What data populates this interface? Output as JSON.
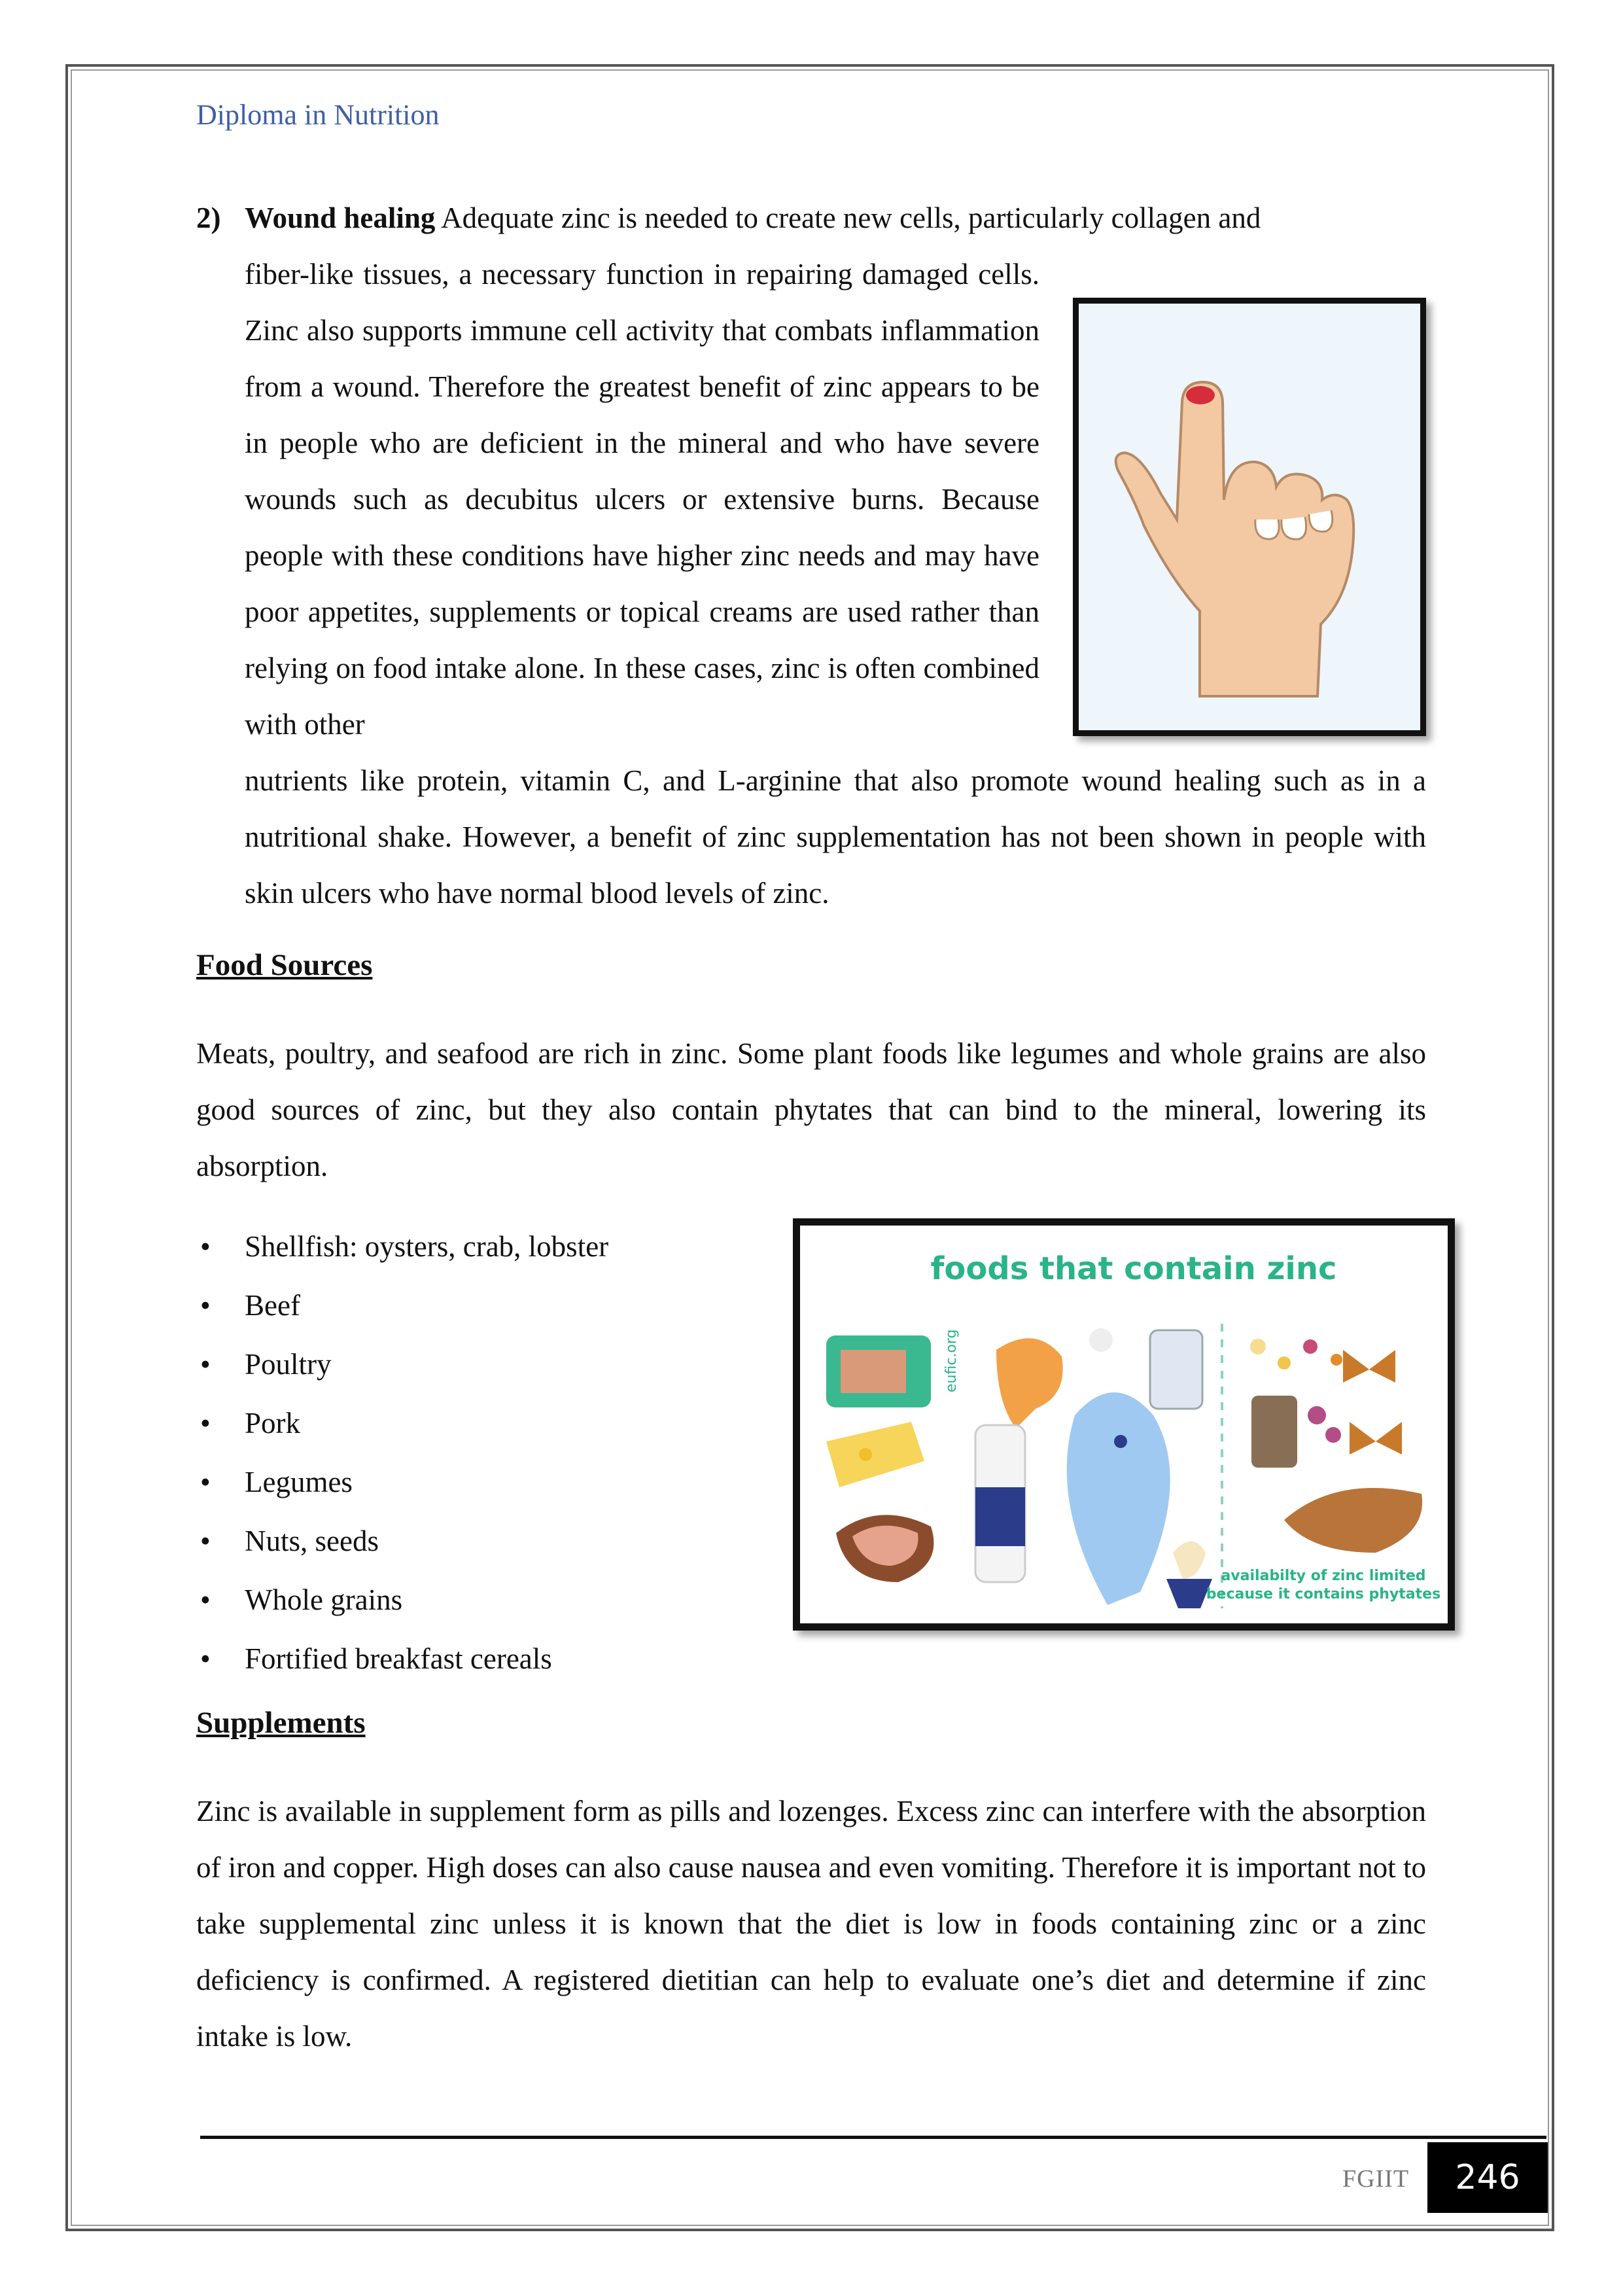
{
  "header": {
    "title": "Diploma in Nutrition"
  },
  "wound": {
    "number": "2)",
    "lead": "Wound healing",
    "line1": " Adequate zinc is needed to create new cells, particularly collagen and",
    "body_narrow": "fiber-like tissues, a necessary function in repairing damaged cells. Zinc also supports immune cell activity that combats inflammation from a wound. Therefore the greatest benefit of zinc appears to be in people who are deficient in the mineral and who have severe wounds such as decubitus ulcers or extensive burns. Because people with these conditions have higher zinc needs and may have poor appetites, supplements or topical creams are used rather than relying on food intake alone. In these cases, zinc is often combined with other",
    "body_wide": "nutrients like protein, vitamin C, and L-arginine that also promote wound healing such as in a nutritional shake. However, a benefit of zinc supplementation has not been shown in people with skin ulcers who have normal blood levels of zinc."
  },
  "food_sources": {
    "heading": "Food Sources",
    "text": "Meats, poultry, and seafood are rich in zinc. Some plant foods like legumes and whole grains are also good sources of zinc, but they also contain phytates that can bind to the mineral, lowering its absorption.",
    "items": [
      "Shellfish: oysters, crab, lobster",
      "Beef",
      "Poultry",
      "Pork",
      "Legumes",
      "Nuts, seeds",
      "Whole grains",
      "Fortified breakfast cereals"
    ]
  },
  "infographic": {
    "title": "foods that contain zinc",
    "watermark": "eufic.org",
    "note_line1": "availabilty of zinc limited",
    "note_line2": "because it contains phytates",
    "accent_color": "#2bb389"
  },
  "supplements": {
    "heading": "Supplements",
    "text": "Zinc is available in supplement form as pills and lozenges. Excess zinc can interfere with the absorption of iron and copper. High doses can also cause nausea and even vomiting. Therefore it is important not to take supplemental zinc unless it is known that the diet is low in foods containing zinc or a zinc deficiency is confirmed. A registered dietitian can help to evaluate one’s diet and determine if zinc intake is low."
  },
  "footer": {
    "label": "FGIIT",
    "page": "246"
  },
  "bullet": "•"
}
